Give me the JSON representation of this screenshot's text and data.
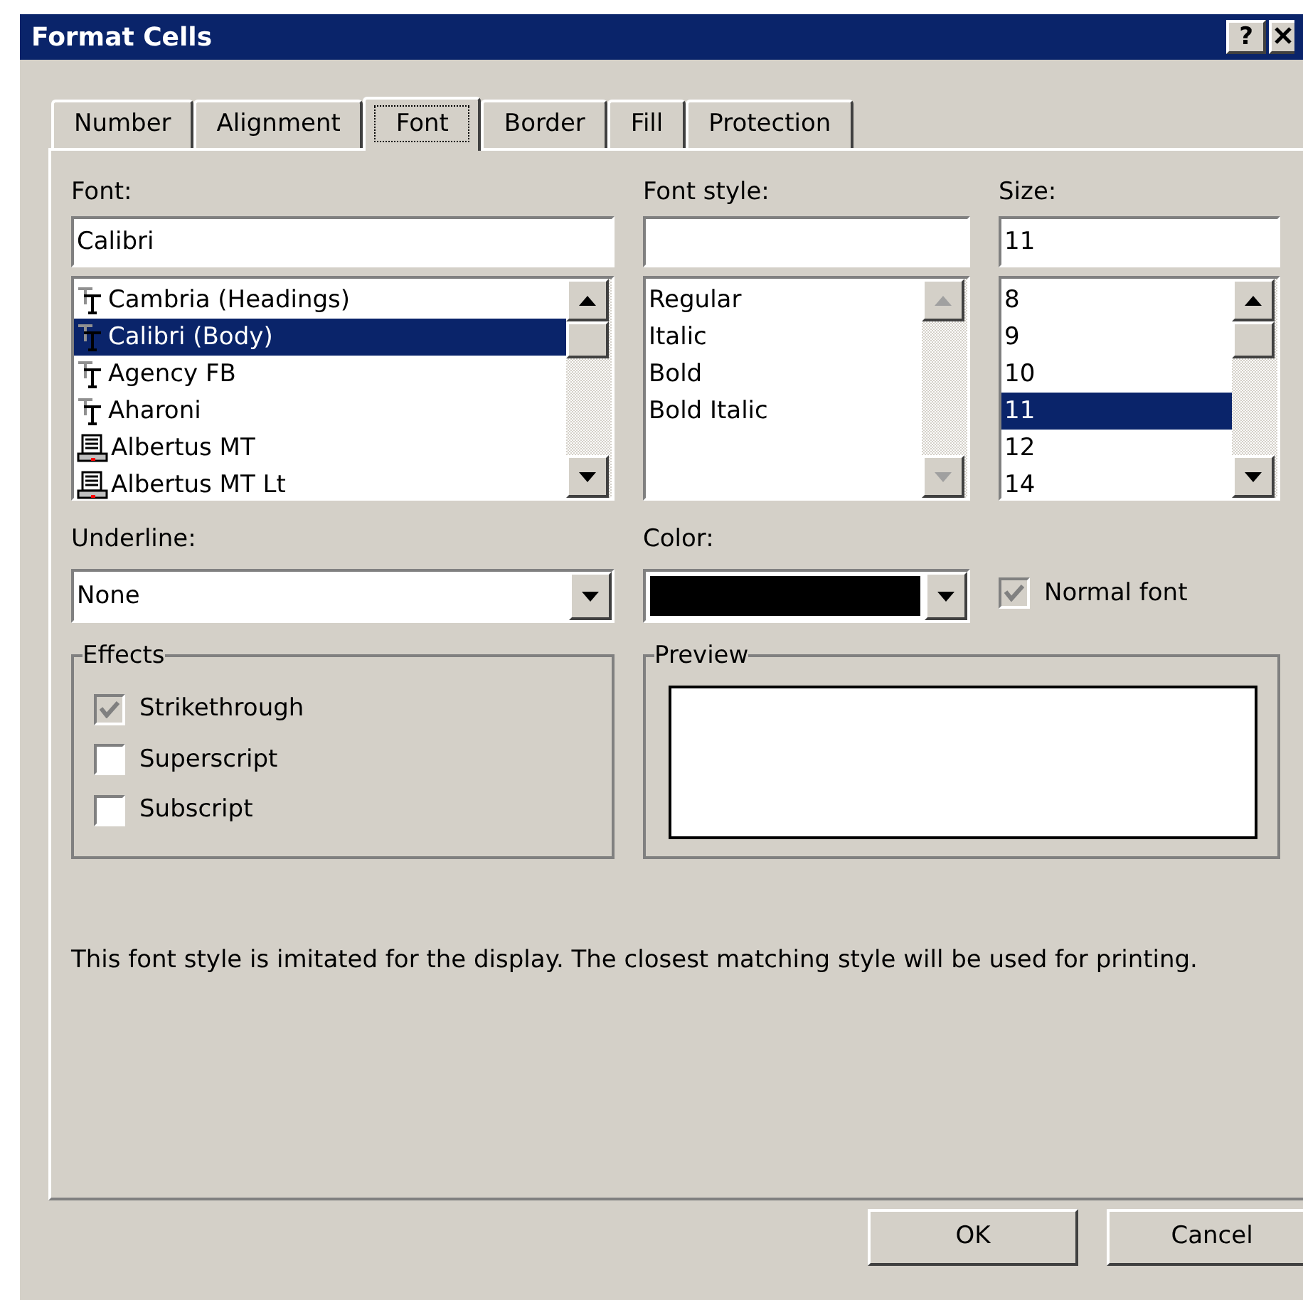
{
  "window": {
    "title": "Format Cells",
    "help_button": "?"
  },
  "tabs": [
    {
      "label": "Number",
      "selected": false
    },
    {
      "label": "Alignment",
      "selected": false
    },
    {
      "label": "Font",
      "selected": true
    },
    {
      "label": "Border",
      "selected": false
    },
    {
      "label": "Fill",
      "selected": false
    },
    {
      "label": "Protection",
      "selected": false
    }
  ],
  "font": {
    "label": "Font:",
    "value": "Calibri",
    "items": [
      {
        "label": "Cambria (Headings)",
        "kind": "truetype",
        "selected": false
      },
      {
        "label": "Calibri (Body)",
        "kind": "truetype",
        "selected": true
      },
      {
        "label": "Agency FB",
        "kind": "truetype",
        "selected": false
      },
      {
        "label": "Aharoni",
        "kind": "truetype",
        "selected": false
      },
      {
        "label": "Albertus MT",
        "kind": "printer",
        "selected": false
      },
      {
        "label": "Albertus MT Lt",
        "kind": "printer",
        "selected": false
      }
    ]
  },
  "font_style": {
    "label": "Font style:",
    "items": [
      {
        "label": "Regular",
        "selected": false
      },
      {
        "label": "Italic",
        "selected": false
      },
      {
        "label": "Bold",
        "selected": false
      },
      {
        "label": "Bold Italic",
        "selected": false
      }
    ]
  },
  "size": {
    "label": "Size:",
    "value": "11",
    "items": [
      {
        "label": "8",
        "selected": false
      },
      {
        "label": "9",
        "selected": false
      },
      {
        "label": "10",
        "selected": false
      },
      {
        "label": "11",
        "selected": true
      },
      {
        "label": "12",
        "selected": false
      },
      {
        "label": "14",
        "selected": false
      }
    ]
  },
  "underline": {
    "label": "Underline:",
    "value": "None"
  },
  "color": {
    "label": "Color:",
    "color": "#000000"
  },
  "normal_font": {
    "label": "Normal font",
    "checked": true,
    "disabled": true
  },
  "effects": {
    "title": "Effects",
    "options": [
      {
        "label": "Strikethrough",
        "checked": true,
        "disabled": true
      },
      {
        "label": "Superscript",
        "checked": false,
        "disabled": false
      },
      {
        "label": "Subscript",
        "checked": false,
        "disabled": false
      }
    ]
  },
  "preview": {
    "title": "Preview"
  },
  "note": "This font style is imitated for the display.  The closest matching style will be used for printing.",
  "buttons": [
    "OK",
    "Cancel"
  ]
}
